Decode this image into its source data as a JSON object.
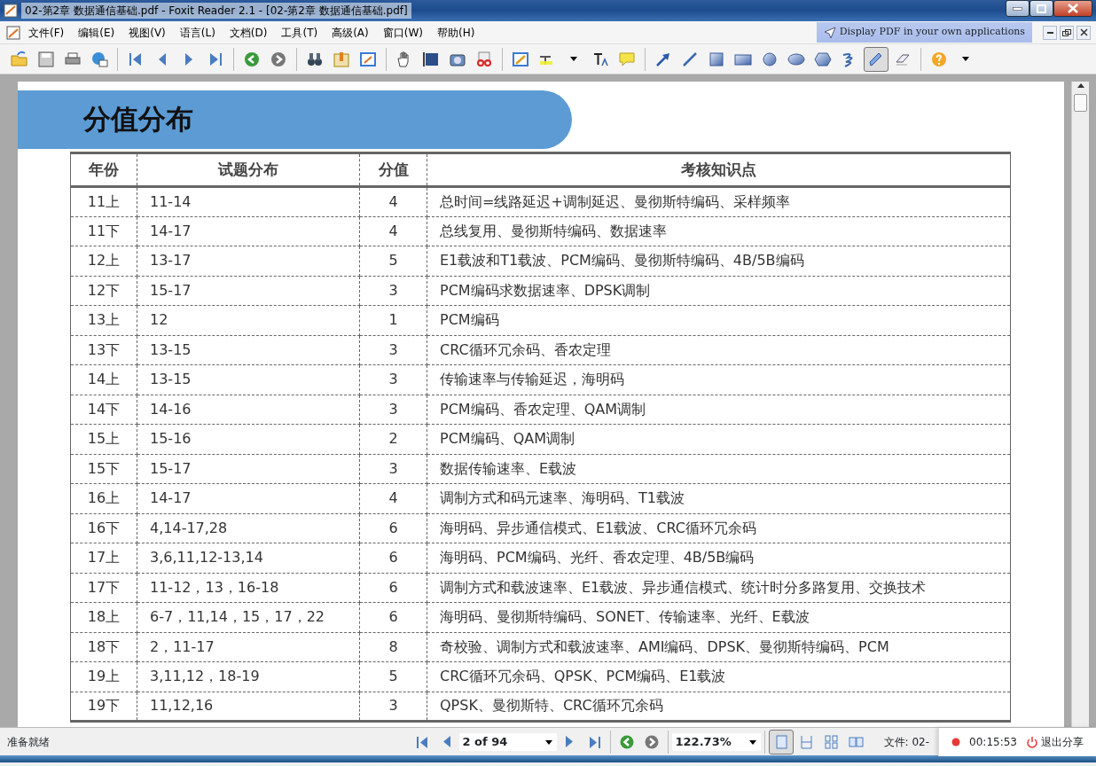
{
  "window": {
    "title": "02-第2章 数据通信基础.pdf - Foxit Reader 2.1 - [02-第2章 数据通信基础.pdf]"
  },
  "menu": [
    "文件(F)",
    "编辑(E)",
    "视图(V)",
    "语言(L)",
    "文档(D)",
    "工具(T)",
    "高级(A)",
    "窗口(W)",
    "帮助(H)"
  ],
  "promo": "Display PDF in your own applications",
  "annotation_tools": [
    {
      "selected": false
    },
    {
      "selected": false
    },
    {
      "selected": false
    },
    {
      "selected": false
    },
    {
      "selected": false
    },
    {
      "selected": false
    },
    {
      "selected": false
    },
    {
      "selected": false
    },
    {
      "selected": true
    },
    {
      "selected": false
    }
  ],
  "page": {
    "heading": "分值分布",
    "table": {
      "columns": [
        "年份",
        "试题分布",
        "分值",
        "考核知识点"
      ],
      "rows": [
        [
          "11上",
          "11-14",
          "4",
          "总时间=线路延迟+调制延迟、曼彻斯特编码、采样频率"
        ],
        [
          "11下",
          "14-17",
          "4",
          "总线复用、曼彻斯特编码、数据速率"
        ],
        [
          "12上",
          "13-17",
          "5",
          "E1载波和T1载波、PCM编码、曼彻斯特编码、4B/5B编码"
        ],
        [
          "12下",
          "15-17",
          "3",
          "PCM编码求数据速率、DPSK调制"
        ],
        [
          "13上",
          "12",
          "1",
          "PCM编码"
        ],
        [
          "13下",
          "13-15",
          "3",
          "CRC循环冗余码、香农定理"
        ],
        [
          "14上",
          "13-15",
          "3",
          "传输速率与传输延迟，海明码"
        ],
        [
          "14下",
          "14-16",
          "3",
          "PCM编码、香农定理、QAM调制"
        ],
        [
          "15上",
          "15-16",
          "2",
          "PCM编码、QAM调制"
        ],
        [
          "15下",
          "15-17",
          "3",
          "数据传输速率、E载波"
        ],
        [
          "16上",
          "14-17",
          "4",
          "调制方式和码元速率、海明码、T1载波"
        ],
        [
          "16下",
          "4,14-17,28",
          "6",
          "海明码、异步通信模式、E1载波、CRC循环冗余码"
        ],
        [
          "17上",
          "3,6,11,12-13,14",
          "6",
          "海明码、PCM编码、光纤、香农定理、4B/5B编码"
        ],
        [
          "17下",
          "11-12，13，16-18",
          "6",
          "调制方式和载波速率、E1载波、异步通信模式、统计时分多路复用、交换技术"
        ],
        [
          "18上",
          "6-7，11,14，15，17，22",
          "6",
          "海明码、曼彻斯特编码、SONET、传输速率、光纤、E载波"
        ],
        [
          "18下",
          "2，11-17",
          "8",
          "奇校验、调制方式和载波速率、AMI编码、DPSK、曼彻斯特编码、PCM"
        ],
        [
          "19上",
          "3,11,12，18-19",
          "5",
          "CRC循环冗余码、QPSK、PCM编码、E1载波"
        ],
        [
          "19下",
          "11,12,16",
          "3",
          "QPSK、曼彻斯特、CRC循环冗余码"
        ]
      ]
    }
  },
  "status_bar": {
    "status": "准备就绪",
    "page_field": "2 of 94",
    "zoom_field": "122.73%",
    "view_modes": [
      {
        "selected": true
      },
      {
        "selected": false
      },
      {
        "selected": false
      },
      {
        "selected": false
      }
    ],
    "file_label": "文件: 02-"
  },
  "recording": {
    "time": "00:15:53",
    "stop_label": "退出分享"
  }
}
